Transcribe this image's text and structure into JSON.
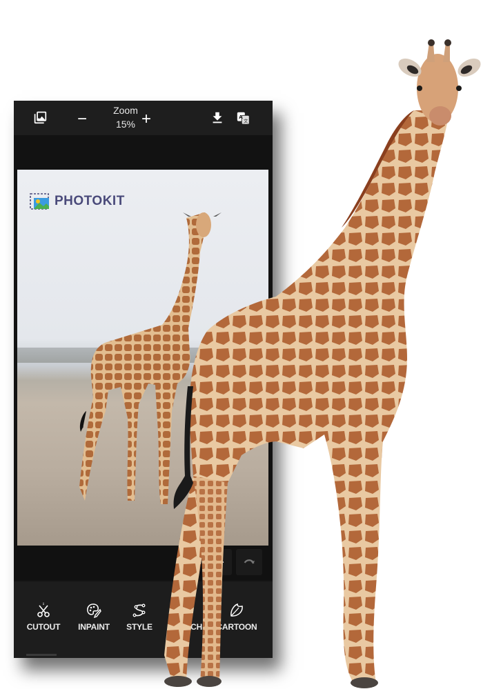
{
  "topbar": {
    "zoom_label": "Zoom",
    "zoom_value": "15%",
    "zoom_minus": "−",
    "zoom_plus": "+",
    "icons": [
      "gallery-icon",
      "download-icon",
      "translate-icon"
    ]
  },
  "canvas": {
    "logo_text": "PHOTOKIT"
  },
  "history": {
    "undo_icon": "undo-icon",
    "redo_icon": "redo-icon"
  },
  "toolbar": {
    "tools": [
      {
        "label": "CUTOUT",
        "icon": "scissors-icon"
      },
      {
        "label": "INPAINT",
        "icon": "palette-icon"
      },
      {
        "label": "STYLE",
        "icon": "style-path-icon"
      },
      {
        "label": "SKETCH",
        "icon": "pencil-icon"
      },
      {
        "label": "CARTOON",
        "icon": "leaf-icon"
      }
    ]
  },
  "colors": {
    "panel_bg": "#141414",
    "topbar_bg": "#1e1e1e",
    "toolbar_bg": "#1d1d1d",
    "logo_text": "#4a4a7a",
    "giraffe_base": "#d9a878",
    "giraffe_spot": "#a85a30"
  }
}
